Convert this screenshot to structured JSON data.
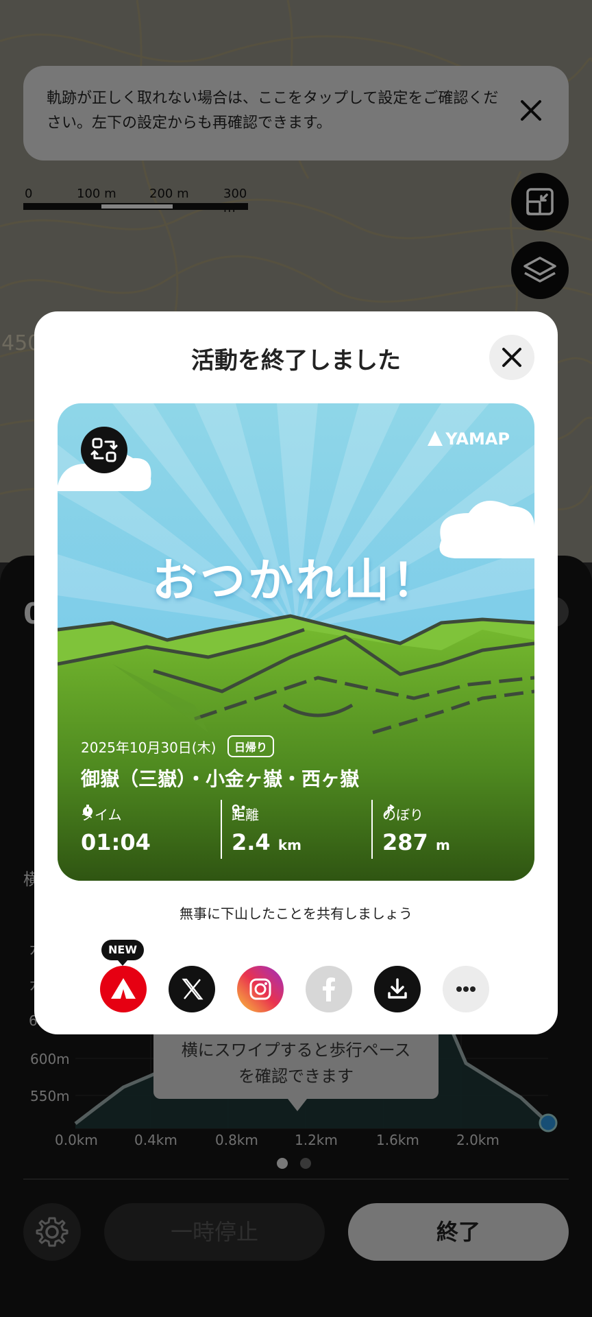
{
  "banner": {
    "message": "軌跡が正しく取れない場合は、ここをタップして設定をご確認ください。左下の設定からも再確認できます。",
    "close_icon": "close-icon"
  },
  "map": {
    "scale_labels": [
      "0",
      "100 m",
      "200 m",
      "300 m"
    ],
    "contour_label": "450",
    "buttons": [
      "map-resize-icon",
      "layers-icon"
    ]
  },
  "sheet": {
    "elapsed_partial": "0",
    "side_label": "横",
    "side_labels_left": [
      "カ",
      "カ",
      "6"
    ],
    "tooltip": "横にスワイプすると歩行ペース\nを確認できます",
    "page_dots": 2,
    "pause_label": "一時停止",
    "end_label": "終了",
    "settings_icon": "gear-icon"
  },
  "elevation_chart": {
    "y_ticks": [
      "600m",
      "550m"
    ],
    "x_ticks": [
      "0.0km",
      "0.4km",
      "0.8km",
      "1.2km",
      "1.6km",
      "2.0km"
    ]
  },
  "modal": {
    "title": "活動を終了しました",
    "card": {
      "brand": "YAMAP",
      "headline": "おつかれ山！",
      "date": "2025年10月30日(木)",
      "badge": "日帰り",
      "route": "御嶽（三嶽）・小金ヶ嶽・西ヶ嶽",
      "stats": [
        {
          "label": "タイム",
          "value": "01:04",
          "unit": "",
          "icon": "timer-icon"
        },
        {
          "label": "距離",
          "value": "2.4",
          "unit": "km",
          "icon": "route-icon"
        },
        {
          "label": "のぼり",
          "value": "287",
          "unit": "m",
          "icon": "ascent-icon"
        }
      ]
    },
    "share_prompt": "無事に下山したことを共有しましょう",
    "new_badge": "NEW",
    "share_buttons": [
      "yamap-icon",
      "x-icon",
      "instagram-icon",
      "facebook-icon",
      "download-icon",
      "more-icon"
    ]
  },
  "colors": {
    "accent_red": "#e60012",
    "map_background": "#8f8c82",
    "end_button": "#d6d6d6",
    "sky_top": "#4aa3e0",
    "grass": "#6db52a"
  }
}
